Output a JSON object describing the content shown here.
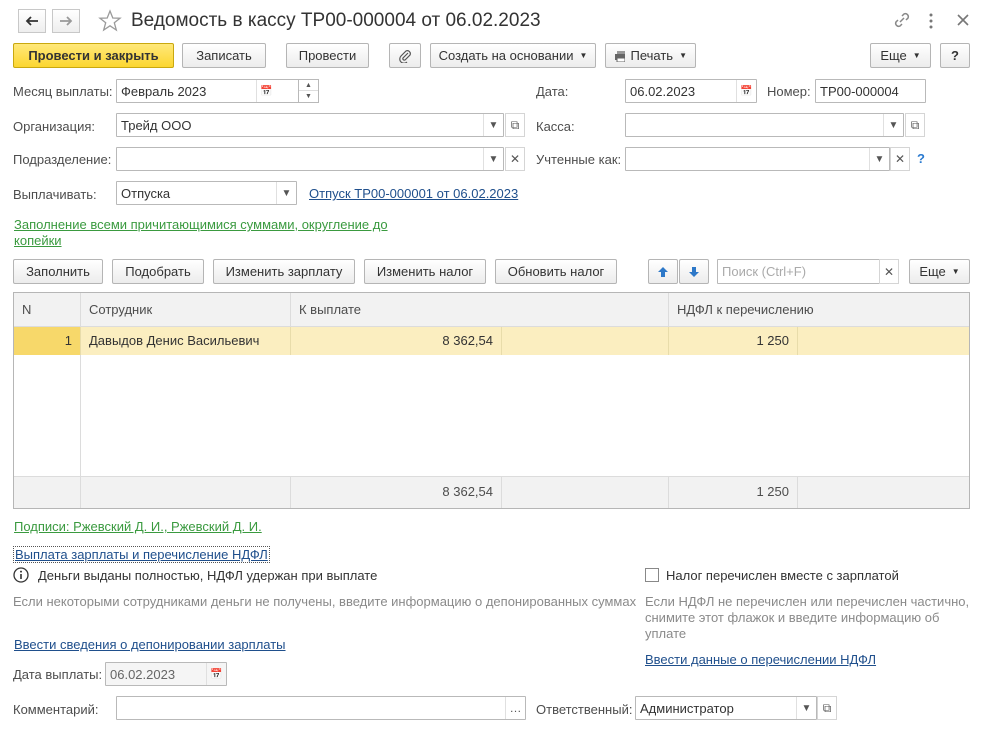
{
  "window": {
    "title": "Ведомость в кассу ТР00-000004 от 06.02.2023"
  },
  "toolbar": {
    "post_close": "Провести и закрыть",
    "write": "Записать",
    "post": "Провести",
    "create_basis": "Создать на основании",
    "print": "Печать",
    "more": "Еще",
    "help": "?"
  },
  "form": {
    "month_label": "Месяц выплаты:",
    "month_value": "Февраль 2023",
    "date_label": "Дата:",
    "date_value": "06.02.2023",
    "number_label": "Номер:",
    "number_value": "ТР00-000004",
    "org_label": "Организация:",
    "org_value": "Трейд ООО",
    "cash_label": "Касса:",
    "cash_value": "",
    "dept_label": "Подразделение:",
    "dept_value": "",
    "accounted_label": "Учтенные как:",
    "accounted_value": "",
    "accounted_help": "?",
    "pay_label": "Выплачивать:",
    "pay_value": "Отпуска",
    "pay_link": "Отпуск ТР00-000001 от 06.02.2023",
    "fill_hint_line1": "Заполнение всеми причитающимися суммами, округление до",
    "fill_hint_line2": "копейки"
  },
  "table_toolbar": {
    "fill": "Заполнить",
    "pick": "Подобрать",
    "change_salary": "Изменить зарплату",
    "change_tax": "Изменить налог",
    "update_tax": "Обновить налог",
    "search_placeholder": "Поиск (Ctrl+F)",
    "more": "Еще"
  },
  "table": {
    "headers": [
      "N",
      "Сотрудник",
      "К выплате",
      "НДФЛ к перечислению"
    ],
    "rows": [
      {
        "n": "1",
        "employee": "Давыдов Денис Васильевич",
        "pay": "8 362,54",
        "tax": "1 250"
      }
    ],
    "totals": {
      "pay": "8 362,54",
      "tax": "1 250"
    }
  },
  "bottom": {
    "signatures_link": "Подписи: Ржевский Д. И., Ржевский Д. И.",
    "section_link": "Выплата зарплаты и перечисление НДФЛ",
    "info_text": "Деньги выданы полностью, НДФЛ удержан при выплате",
    "deposit_hint": "Если некоторыми сотрудниками деньги не получены, введите информацию о депонированных суммах",
    "deposit_link": "Ввести сведения о депонировании зарплаты",
    "tax_checkbox_label": "Налог перечислен вместе с зарплатой",
    "tax_hint_line1": "Если НДФЛ не перечислен или перечислен частично,",
    "tax_hint_line2": "снимите этот флажок и введите информацию об",
    "tax_hint_line3": "уплате",
    "tax_link": "Ввести данные о перечислении НДФЛ",
    "pay_date_label": "Дата выплаты:",
    "pay_date_value": "06.02.2023",
    "comment_label": "Комментарий:",
    "comment_value": "",
    "responsible_label": "Ответственный:",
    "responsible_value": "Администратор"
  },
  "colors": {
    "primary_button": "#fcd630",
    "selected_row": "#fbeec0",
    "link_blue": "#1f4f8c",
    "link_green": "#3a9a3f"
  }
}
